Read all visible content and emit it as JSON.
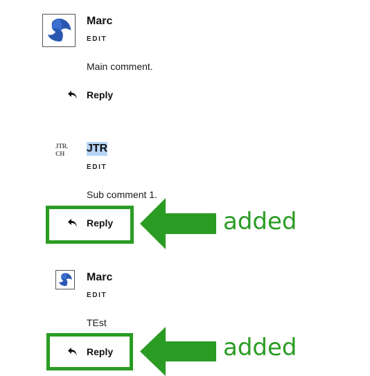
{
  "comments": [
    {
      "author": "Marc",
      "edit_label": "EDIT",
      "text": "Main comment.",
      "reply_label": "Reply",
      "avatar_icon": "blue-swirl-avatar-icon"
    },
    {
      "author": "JTR",
      "edit_label": "EDIT",
      "text": "Sub comment 1.",
      "reply_label": "Reply",
      "avatar_icon": "jtr-text-avatar-icon",
      "avatar_text_line1": "JTR.",
      "avatar_text_line2": "CH",
      "author_selected": true
    },
    {
      "author": "Marc",
      "edit_label": "EDIT",
      "text": "TEst",
      "reply_label": "Reply",
      "avatar_icon": "blue-swirl-avatar-icon"
    }
  ],
  "annotations": [
    {
      "label": "added"
    },
    {
      "label": "added"
    }
  ],
  "colors": {
    "annotation_green": "#2a9c24",
    "selection_blue": "#b7d5f5",
    "avatar_blue": "#2a57b0"
  }
}
